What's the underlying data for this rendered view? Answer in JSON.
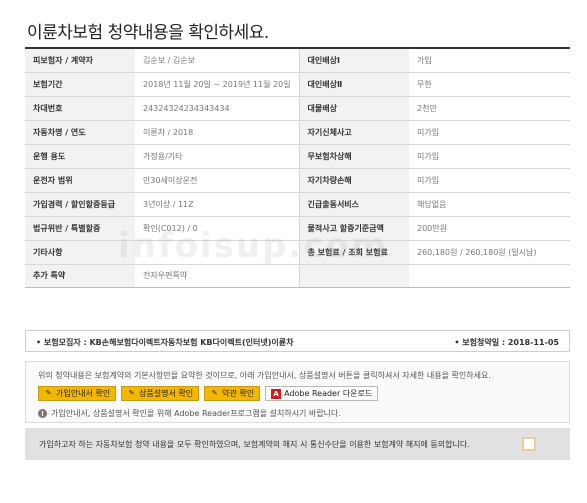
{
  "page": {
    "title": "이륜차보험 청약내용을 확인하세요."
  },
  "rows": [
    {
      "l_label": "피보험자 / 계약자",
      "l_value": "김순보 / 김순보",
      "r_label": "대인배상Ⅰ",
      "r_value": "가입"
    },
    {
      "l_label": "보험기간",
      "l_value": "2018년 11월 20일 ~ 2019년 11월 20일",
      "r_label": "대인배상Ⅱ",
      "r_value": "무한"
    },
    {
      "l_label": "차대번호",
      "l_value": "24324324234343434",
      "r_label": "대물배상",
      "r_value": "2천만"
    },
    {
      "l_label": "자동차명 / 연도",
      "l_value": "이륜차 / 2018",
      "r_label": "자기신체사고",
      "r_value": "미가입"
    },
    {
      "l_label": "운행 용도",
      "l_value": "가정용/기타",
      "r_label": "무보험차상해",
      "r_value": "미가입"
    },
    {
      "l_label": "운전자 범위",
      "l_value": "만30세이상운전",
      "r_label": "자기차량손해",
      "r_value": "미가입"
    },
    {
      "l_label": "가입경력 / 할인할증등급",
      "l_value": "3년이상 / 11Z",
      "r_label": "긴급출동서비스",
      "r_value": "해당없음"
    },
    {
      "l_label": "법규위반 / 특별할증",
      "l_value": "확인(C012) / 0",
      "r_label": "물적사고 할증기준금액",
      "r_value": "200만원"
    },
    {
      "l_label": "기타사항",
      "l_value": "",
      "r_label": "총 보험료 / 조회 보험료",
      "r_value": "260,180원 / 260,180원 (일시납)"
    },
    {
      "l_label": "추가 특약",
      "l_value": "전자우편특약",
      "r_label": "",
      "r_value": ""
    }
  ],
  "recruiter": {
    "left": "• 보험모집자 : KB손해보험다이렉트자동차보험 KB다이렉트(인터넷)이륜차",
    "right": "• 보험청약일 : 2018-11-05"
  },
  "notice": {
    "text": "위의 청약내용은 보험계약의 기본사항만을 요약한 것이므로, 아래 가입안내서, 상품설명서 버튼을 클릭하셔서 자세한 내용을 확인하세요.",
    "buttons": {
      "guide": "가입안내서 확인",
      "product": "상품설명서 확인",
      "terms": "약관 확인",
      "adobe": "Adobe Reader 다운로드"
    },
    "install_note": "가입안내서, 상품설명서 확인을 위해 Adobe Reader프로그램을 설치하시기 바랍니다."
  },
  "agreement": {
    "text": "가입하고자 하는 자동차보험 청약 내용을 모두 확인하였으며, 보험계약의 해지 시 통신수단을 이용한 보험계약 해지에 동의합니다."
  },
  "watermark": "infoisup.com",
  "colors": {
    "button_accent": "#f4b700",
    "header_cell": "#f2f2f2",
    "agree_bg": "#e1e1e1"
  },
  "icons": {
    "button": "pen-icon",
    "adobe": "pdf-icon",
    "info": "info-icon"
  }
}
